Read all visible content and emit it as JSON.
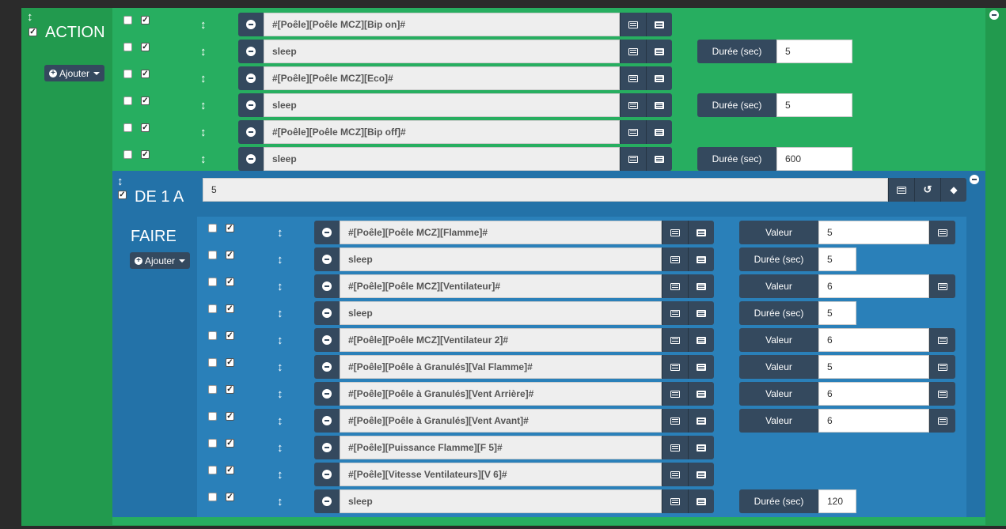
{
  "action_block": {
    "label": "ACTION",
    "add_button": "Ajouter",
    "rows": [
      {
        "cmd": "#[Poêle][Poêle MCZ][Bip on]#"
      },
      {
        "cmd": "sleep",
        "opt_label": "Durée (sec)",
        "opt_value": "5"
      },
      {
        "cmd": "#[Poêle][Poêle MCZ][Eco]#"
      },
      {
        "cmd": "sleep",
        "opt_label": "Durée (sec)",
        "opt_value": "5"
      },
      {
        "cmd": "#[Poêle][Poêle MCZ][Bip off]#"
      },
      {
        "cmd": "sleep",
        "opt_label": "Durée (sec)",
        "opt_value": "600"
      }
    ]
  },
  "loop_block": {
    "label": "DE 1 A",
    "input_value": "5",
    "faire_label": "FAIRE",
    "add_button": "Ajouter",
    "rows": [
      {
        "cmd": "#[Poêle][Poêle MCZ][Flamme]#",
        "opt_label": "Valeur",
        "opt_value": "5",
        "opt_icon": true
      },
      {
        "cmd": "sleep",
        "opt_label": "Durée (sec)",
        "opt_value": "5"
      },
      {
        "cmd": "#[Poêle][Poêle MCZ][Ventilateur]#",
        "opt_label": "Valeur",
        "opt_value": "6",
        "opt_icon": true
      },
      {
        "cmd": "sleep",
        "opt_label": "Durée (sec)",
        "opt_value": "5"
      },
      {
        "cmd": "#[Poêle][Poêle MCZ][Ventilateur 2]#",
        "opt_label": "Valeur",
        "opt_value": "6",
        "opt_icon": true
      },
      {
        "cmd": "#[Poêle][Poêle à Granulés][Val Flamme]#",
        "opt_label": "Valeur",
        "opt_value": "5",
        "opt_icon": true
      },
      {
        "cmd": "#[Poêle][Poêle à Granulés][Vent Arrière]#",
        "opt_label": "Valeur",
        "opt_value": "6",
        "opt_icon": true
      },
      {
        "cmd": "#[Poêle][Poêle à Granulés][Vent Avant]#",
        "opt_label": "Valeur",
        "opt_value": "6",
        "opt_icon": true
      },
      {
        "cmd": "#[Poêle][Puissance Flamme][F 5]#"
      },
      {
        "cmd": "#[Poêle][Vitesse Ventilateurs][V 6]#"
      },
      {
        "cmd": "sleep",
        "opt_label": "Durée (sec)",
        "opt_value": "120"
      }
    ]
  },
  "icons": [
    "updown-arrow-icon",
    "minus-circle-icon",
    "list-icon",
    "table-icon",
    "history-icon",
    "cube-icon",
    "plus-circle-icon",
    "caret-down-icon"
  ],
  "colors": {
    "green_outer": "#229a4e",
    "green_inner": "#27ae60",
    "blue_outer": "#2372a8",
    "blue_inner": "#2a80b9",
    "button_dark": "#34495e"
  }
}
